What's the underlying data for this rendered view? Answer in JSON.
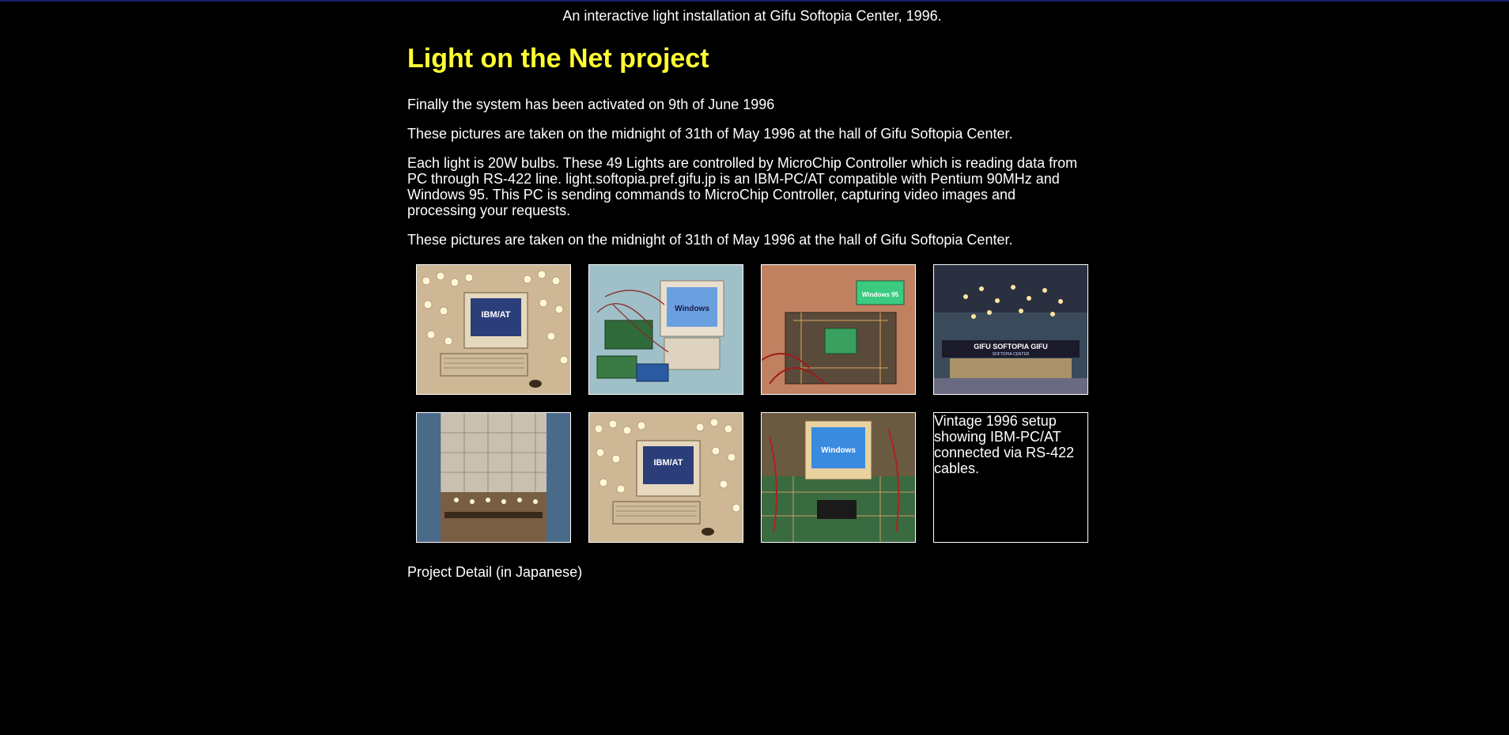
{
  "header": {
    "tagline": "An interactive light installation at Gifu Softopia Center, 1996."
  },
  "main": {
    "title": "Light on the Net project",
    "paragraphs": [
      "Finally the system has been activated on 9th of June 1996",
      "These pictures are taken on the midnight of 31th of May 1996 at the hall of Gifu Softopia Center.",
      "Each light is 20W bulbs. These 49 Lights are controlled by MicroChip Controller which is reading data from PC through RS-422 line. light.softopia.pref.gifu.jp is an IBM-PC/AT compatible with Pentium 90MHz and Windows 95. This PC is sending commands to MicroChip Controller, capturing video images and processing your requests.",
      "These pictures are taken on the midnight of 31th of May 1996 at the hall of Gifu Softopia Center."
    ]
  },
  "gallery": {
    "img_texts": {
      "ibm_at": "IBM/AT",
      "windows": "Windows",
      "windows95": "Windows 95",
      "softopia": "GIFU  SOFTOPIA  GIFU",
      "softopia_sub": "SOFTOPIA CENTER"
    },
    "caption": "Vintage 1996 setup showing IBM-PC/AT connected via RS-422 cables."
  },
  "footer": {
    "detail_link": "Project Detail (in Japanese)"
  }
}
